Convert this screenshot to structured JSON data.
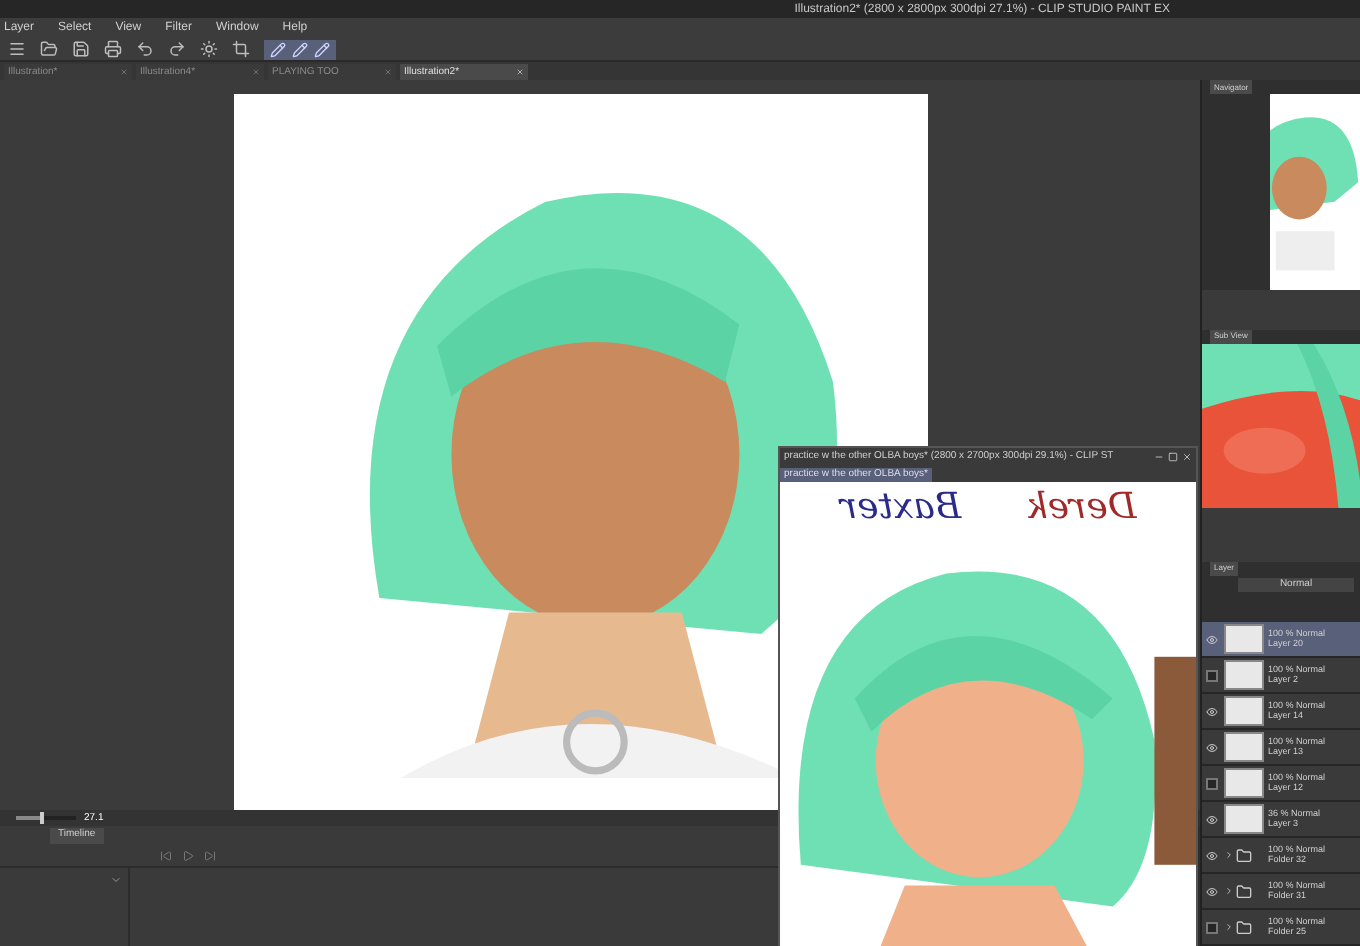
{
  "window": {
    "title": "Illustration2* (2800 x 2800px 300dpi 27.1%) - CLIP STUDIO PAINT EX"
  },
  "menu": [
    "Layer",
    "Select",
    "View",
    "Filter",
    "Window",
    "Help"
  ],
  "document_tabs": [
    {
      "label": "Illustration*",
      "selected": false
    },
    {
      "label": "Illustration4*",
      "selected": false
    },
    {
      "label": "PLAYING TOO",
      "selected": false
    },
    {
      "label": "Illustration2*",
      "selected": true
    }
  ],
  "navigator": {
    "title": "Navigator"
  },
  "sub_view": {
    "title": "Sub View"
  },
  "layer_panel": {
    "title": "Layer",
    "blend_mode": "Normal",
    "layers": [
      {
        "kind": "layer",
        "mode": "100 % Normal",
        "name": "Layer 20",
        "visible": true,
        "selected": true
      },
      {
        "kind": "layer",
        "mode": "100 % Normal",
        "name": "Layer 2",
        "visible": false,
        "selected": false
      },
      {
        "kind": "layer",
        "mode": "100 % Normal",
        "name": "Layer 14",
        "visible": true,
        "selected": false
      },
      {
        "kind": "layer",
        "mode": "100 % Normal",
        "name": "Layer 13",
        "visible": true,
        "selected": false
      },
      {
        "kind": "layer",
        "mode": "100 % Normal",
        "name": "Layer 12",
        "visible": false,
        "selected": false
      },
      {
        "kind": "layer",
        "mode": "36 % Normal",
        "name": "Layer 3",
        "visible": true,
        "selected": false
      },
      {
        "kind": "folder",
        "mode": "100 % Normal",
        "name": "Folder 32",
        "visible": true,
        "selected": false
      },
      {
        "kind": "folder",
        "mode": "100 % Normal",
        "name": "Folder 31",
        "visible": true,
        "selected": false
      },
      {
        "kind": "folder",
        "mode": "100 % Normal",
        "name": "Folder 25",
        "visible": false,
        "selected": false
      }
    ]
  },
  "status_bar": {
    "zoom": "27.1",
    "level": 0.4
  },
  "timeline": {
    "title": "Timeline"
  },
  "second_window": {
    "title": "practice w the other OLBA boys* (2800 x 2700px 300dpi 29.1%) - CLIP ST",
    "tab": "practice w the other OLBA boys*",
    "sketch_texts": [
      "Baxter",
      "Derek"
    ]
  }
}
